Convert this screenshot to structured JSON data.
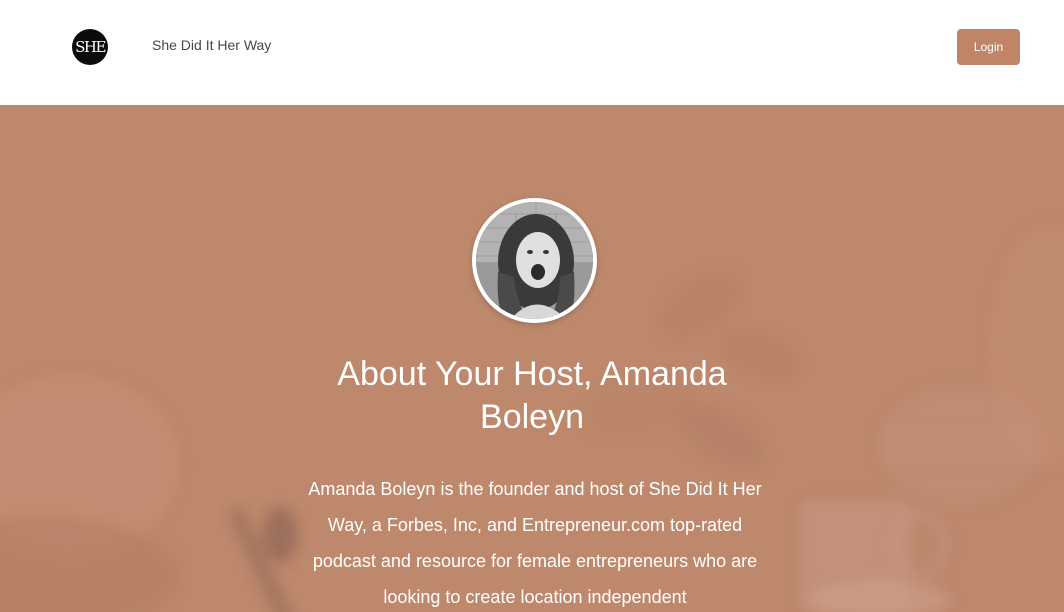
{
  "header": {
    "logo_text": "SHE",
    "site_name": "She Did It Her Way",
    "login_label": "Login"
  },
  "hero": {
    "title": "About Your Host, Amanda Boleyn",
    "bio": "Amanda Boleyn is the founder and host of She Did It Her Way, a Forbes, Inc, and Entrepreneur.com top-rated podcast and resource for female entrepreneurs who are looking to create location independent"
  },
  "colors": {
    "brand_accent": "#c08566",
    "hero_background": "#bd886c",
    "header_background": "#ffffff",
    "nav_text": "#3f4953"
  }
}
